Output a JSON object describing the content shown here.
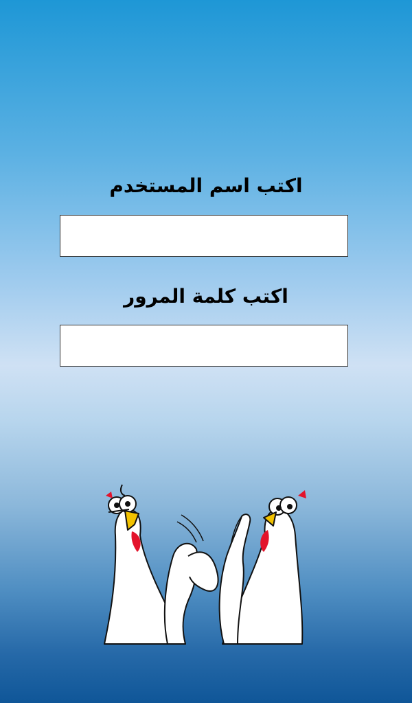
{
  "login": {
    "username_label": "اكتب اسم المستخدم",
    "username_value": "",
    "password_label": "اكتب كلمة المرور",
    "password_value": ""
  },
  "illustration": {
    "icon": "high-five-chickens-illustration"
  },
  "colors": {
    "gradient_top": "#1e97d6",
    "gradient_middle": "#cfe1f4",
    "gradient_bottom": "#0f5698",
    "chicken_comb": "#e3132b",
    "chicken_beak": "#f2c200"
  }
}
